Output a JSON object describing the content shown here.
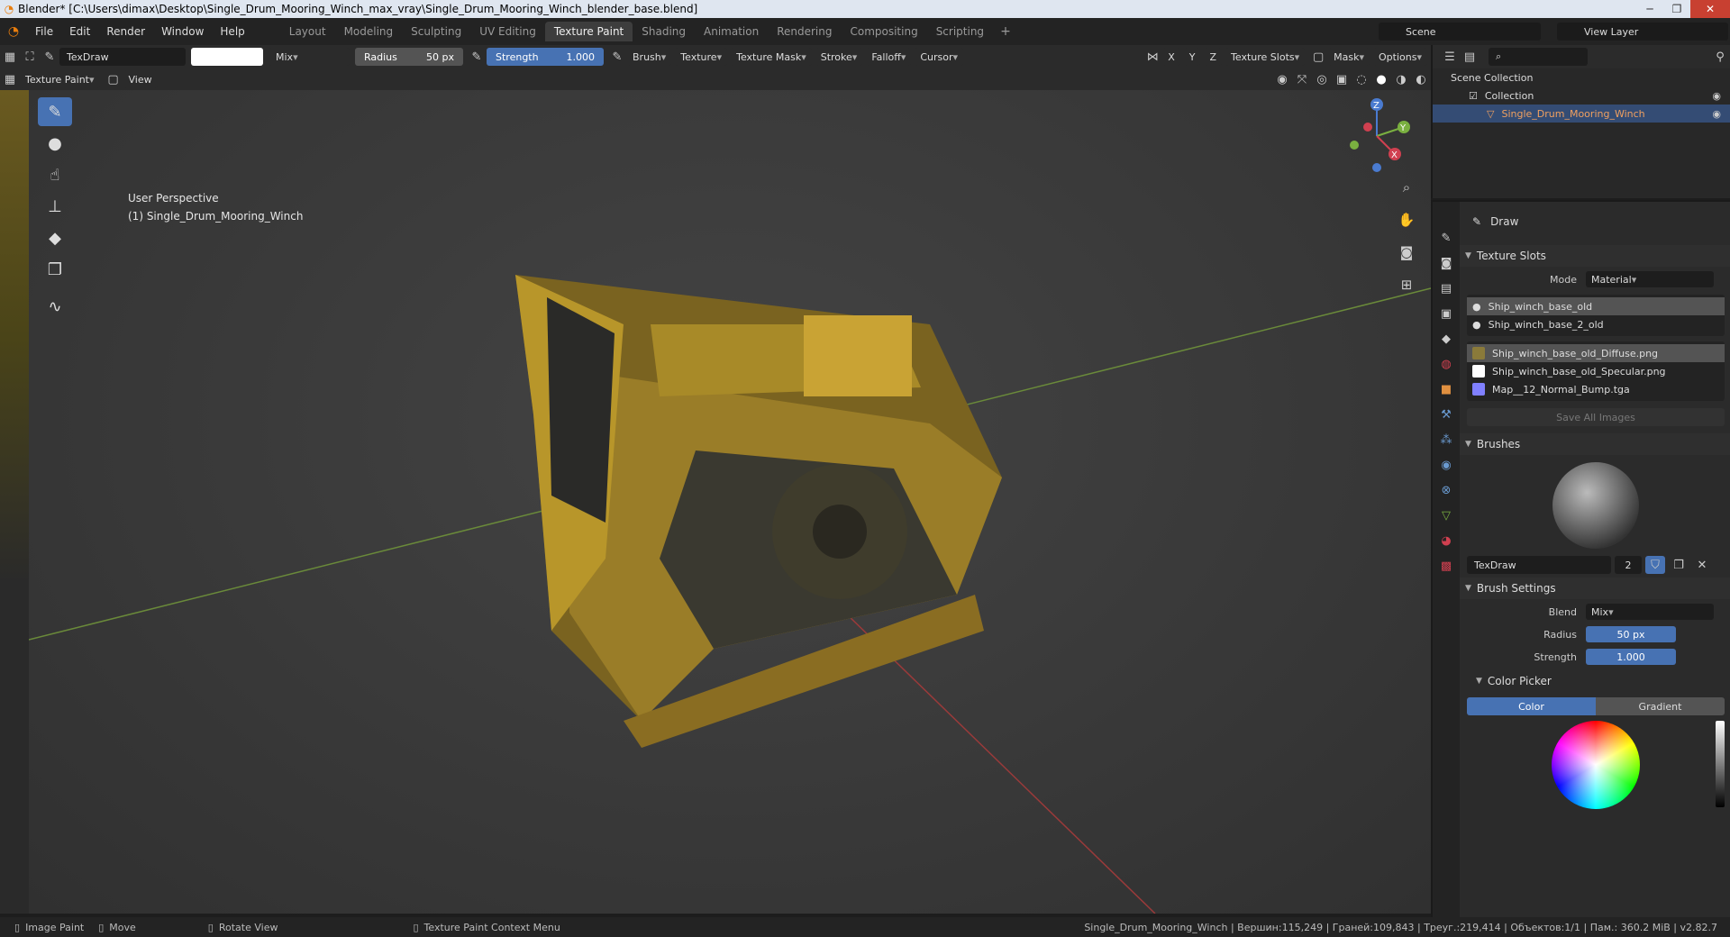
{
  "titlebar": {
    "title": "Blender* [C:\\Users\\dimax\\Desktop\\Single_Drum_Mooring_Winch_max_vray\\Single_Drum_Mooring_Winch_blender_base.blend]"
  },
  "menu": [
    "File",
    "Edit",
    "Render",
    "Window",
    "Help"
  ],
  "workspaces": [
    "Layout",
    "Modeling",
    "Sculpting",
    "UV Editing",
    "Texture Paint",
    "Shading",
    "Animation",
    "Rendering",
    "Compositing",
    "Scripting"
  ],
  "active_workspace": "Texture Paint",
  "scene_name": "Scene",
  "view_layer": "View Layer",
  "header": {
    "brush_name": "TexDraw",
    "blend": "Mix",
    "radius_label": "Radius",
    "radius_value": "50 px",
    "strength_label": "Strength",
    "strength_value": "1.000",
    "menus": [
      "Brush",
      "Texture",
      "Texture Mask",
      "Stroke",
      "Falloff",
      "Cursor"
    ],
    "axes": [
      "X",
      "Y",
      "Z"
    ],
    "texture_slots": "Texture Slots",
    "mask": "Mask",
    "options": "Options"
  },
  "subheader": {
    "mode": "Texture Paint",
    "view": "View"
  },
  "viewport": {
    "perspective": "User Perspective",
    "object_label": "(1) Single_Drum_Mooring_Winch"
  },
  "outliner": {
    "scene_collection": "Scene Collection",
    "collection": "Collection",
    "object": "Single_Drum_Mooring_Winch"
  },
  "properties": {
    "tool_name": "Draw",
    "texture_slots": {
      "header": "Texture Slots",
      "mode_label": "Mode",
      "mode_value": "Material",
      "materials": [
        "Ship_winch_base_old",
        "Ship_winch_base_2_old"
      ],
      "images": [
        {
          "name": "Ship_winch_base_old_Diffuse.png",
          "color": "#8a7a3a"
        },
        {
          "name": "Ship_winch_base_old_Specular.png",
          "color": "#ffffff"
        },
        {
          "name": "Map__12_Normal_Bump.tga",
          "color": "#8080ff"
        }
      ],
      "save_all": "Save All Images"
    },
    "brushes": {
      "header": "Brushes",
      "name": "TexDraw",
      "users": "2"
    },
    "brush_settings": {
      "header": "Brush Settings",
      "blend_label": "Blend",
      "blend_value": "Mix",
      "radius_label": "Radius",
      "radius_value": "50 px",
      "strength_label": "Strength",
      "strength_value": "1.000"
    },
    "color_picker": {
      "header": "Color Picker",
      "tab_color": "Color",
      "tab_gradient": "Gradient"
    }
  },
  "statusbar": {
    "image_paint": "Image Paint",
    "move": "Move",
    "rotate_view": "Rotate View",
    "context_menu": "Texture Paint Context Menu",
    "stats": "Single_Drum_Mooring_Winch | Вершин:115,249 | Граней:109,843 | Треуг.:219,414 | Объектов:1/1 | Пам.: 360.2 MiB | v2.82.7"
  },
  "colors": {
    "accent": "#4772b3",
    "object_orange": "#f0a060",
    "winch_yellow": "#b8962a"
  }
}
